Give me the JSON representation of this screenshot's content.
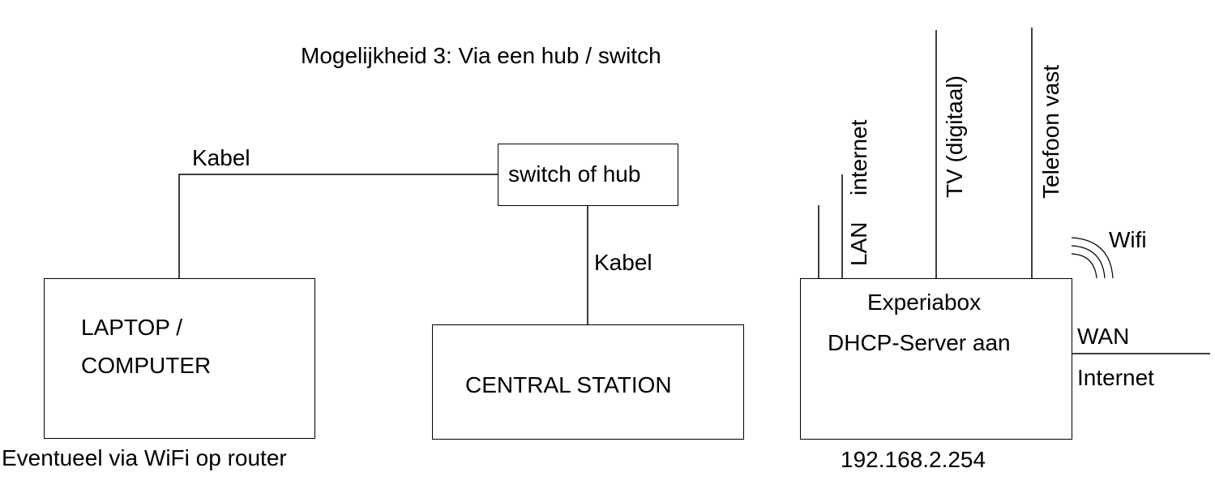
{
  "title": "Mogelijkheid 3: Via een hub / switch",
  "nodes": {
    "switch": {
      "label": "switch of hub"
    },
    "laptop": {
      "line1": "LAPTOP /",
      "line2": "COMPUTER",
      "note": "Eventueel via WiFi op router"
    },
    "central_station": {
      "label": "CENTRAL STATION"
    },
    "experiabox": {
      "line1": "Experiabox",
      "line2": "DHCP-Server aan",
      "ip": "192.168.2.254"
    }
  },
  "connections": {
    "laptop_switch": {
      "label": "Kabel"
    },
    "switch_central": {
      "label": "Kabel"
    }
  },
  "ports": {
    "lan": "LAN",
    "internet": "internet",
    "tv": "TV (digitaal)",
    "telefoon": "Telefoon vast",
    "wifi": "Wifi",
    "wan": "WAN",
    "wan_internet": "Internet"
  },
  "colors": {
    "line": "#000000",
    "background": "#ffffff"
  }
}
